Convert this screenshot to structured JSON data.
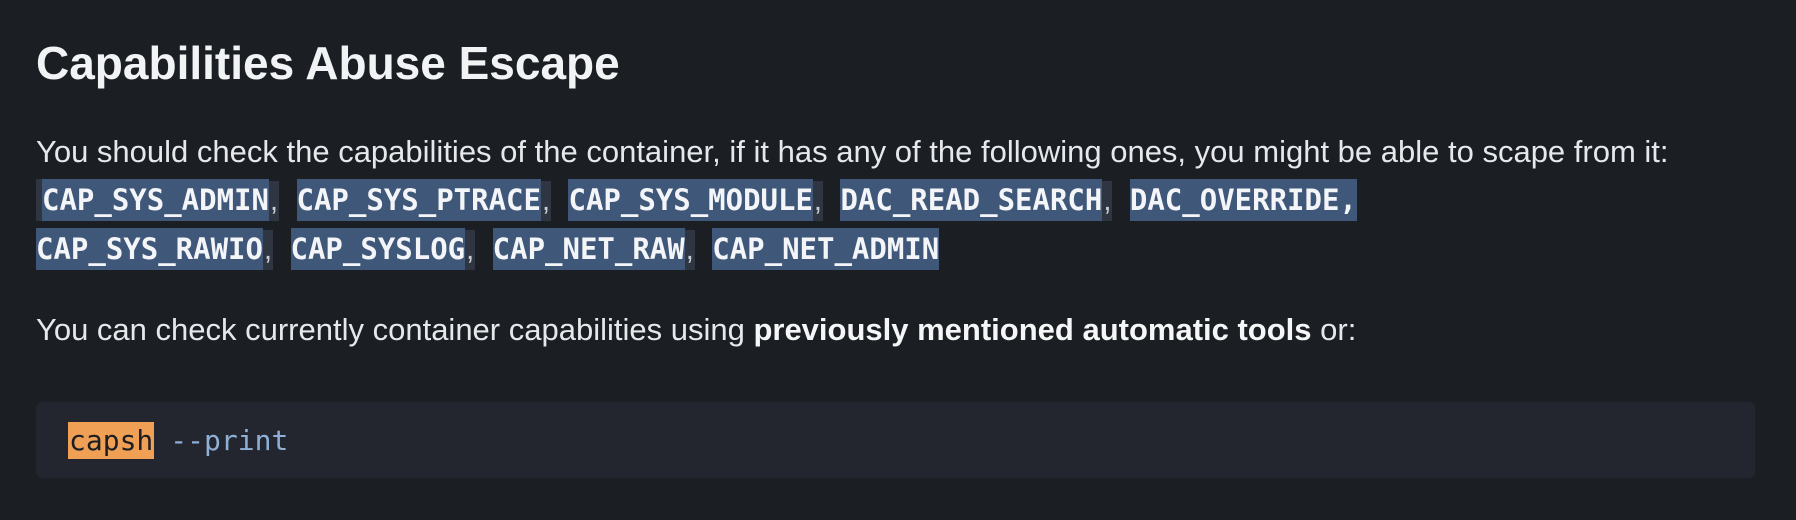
{
  "heading": "Capabilities Abuse Escape",
  "intro": "You should check the capabilities of the container, if it has any of the following ones, you might be able to scape from it:",
  "capabilities": {
    "cap1": "CAP_SYS_ADMIN",
    "cap2": "CAP_SYS_PTRACE",
    "cap3": "CAP_SYS_MODULE",
    "cap4": "DAC_READ_SEARCH",
    "cap5": "DAC_OVERRIDE,",
    "cap6": "CAP_SYS_RAWIO",
    "cap7": "CAP_SYSLOG",
    "cap8": "CAP_NET_RAW",
    "cap9": "CAP_NET_ADMIN",
    "separator": ","
  },
  "para2": {
    "prefix": "You can check currently container capabilities using ",
    "bold": "previously mentioned automatic tools",
    "suffix": " or:"
  },
  "code": {
    "command": "capsh",
    "argument": "--print"
  },
  "colors": {
    "background": "#1b1e22",
    "capability_highlight": "#3f5779",
    "code_background": "#23262e",
    "command_highlight": "#f0a055",
    "argument_text": "#8fb0d6"
  }
}
